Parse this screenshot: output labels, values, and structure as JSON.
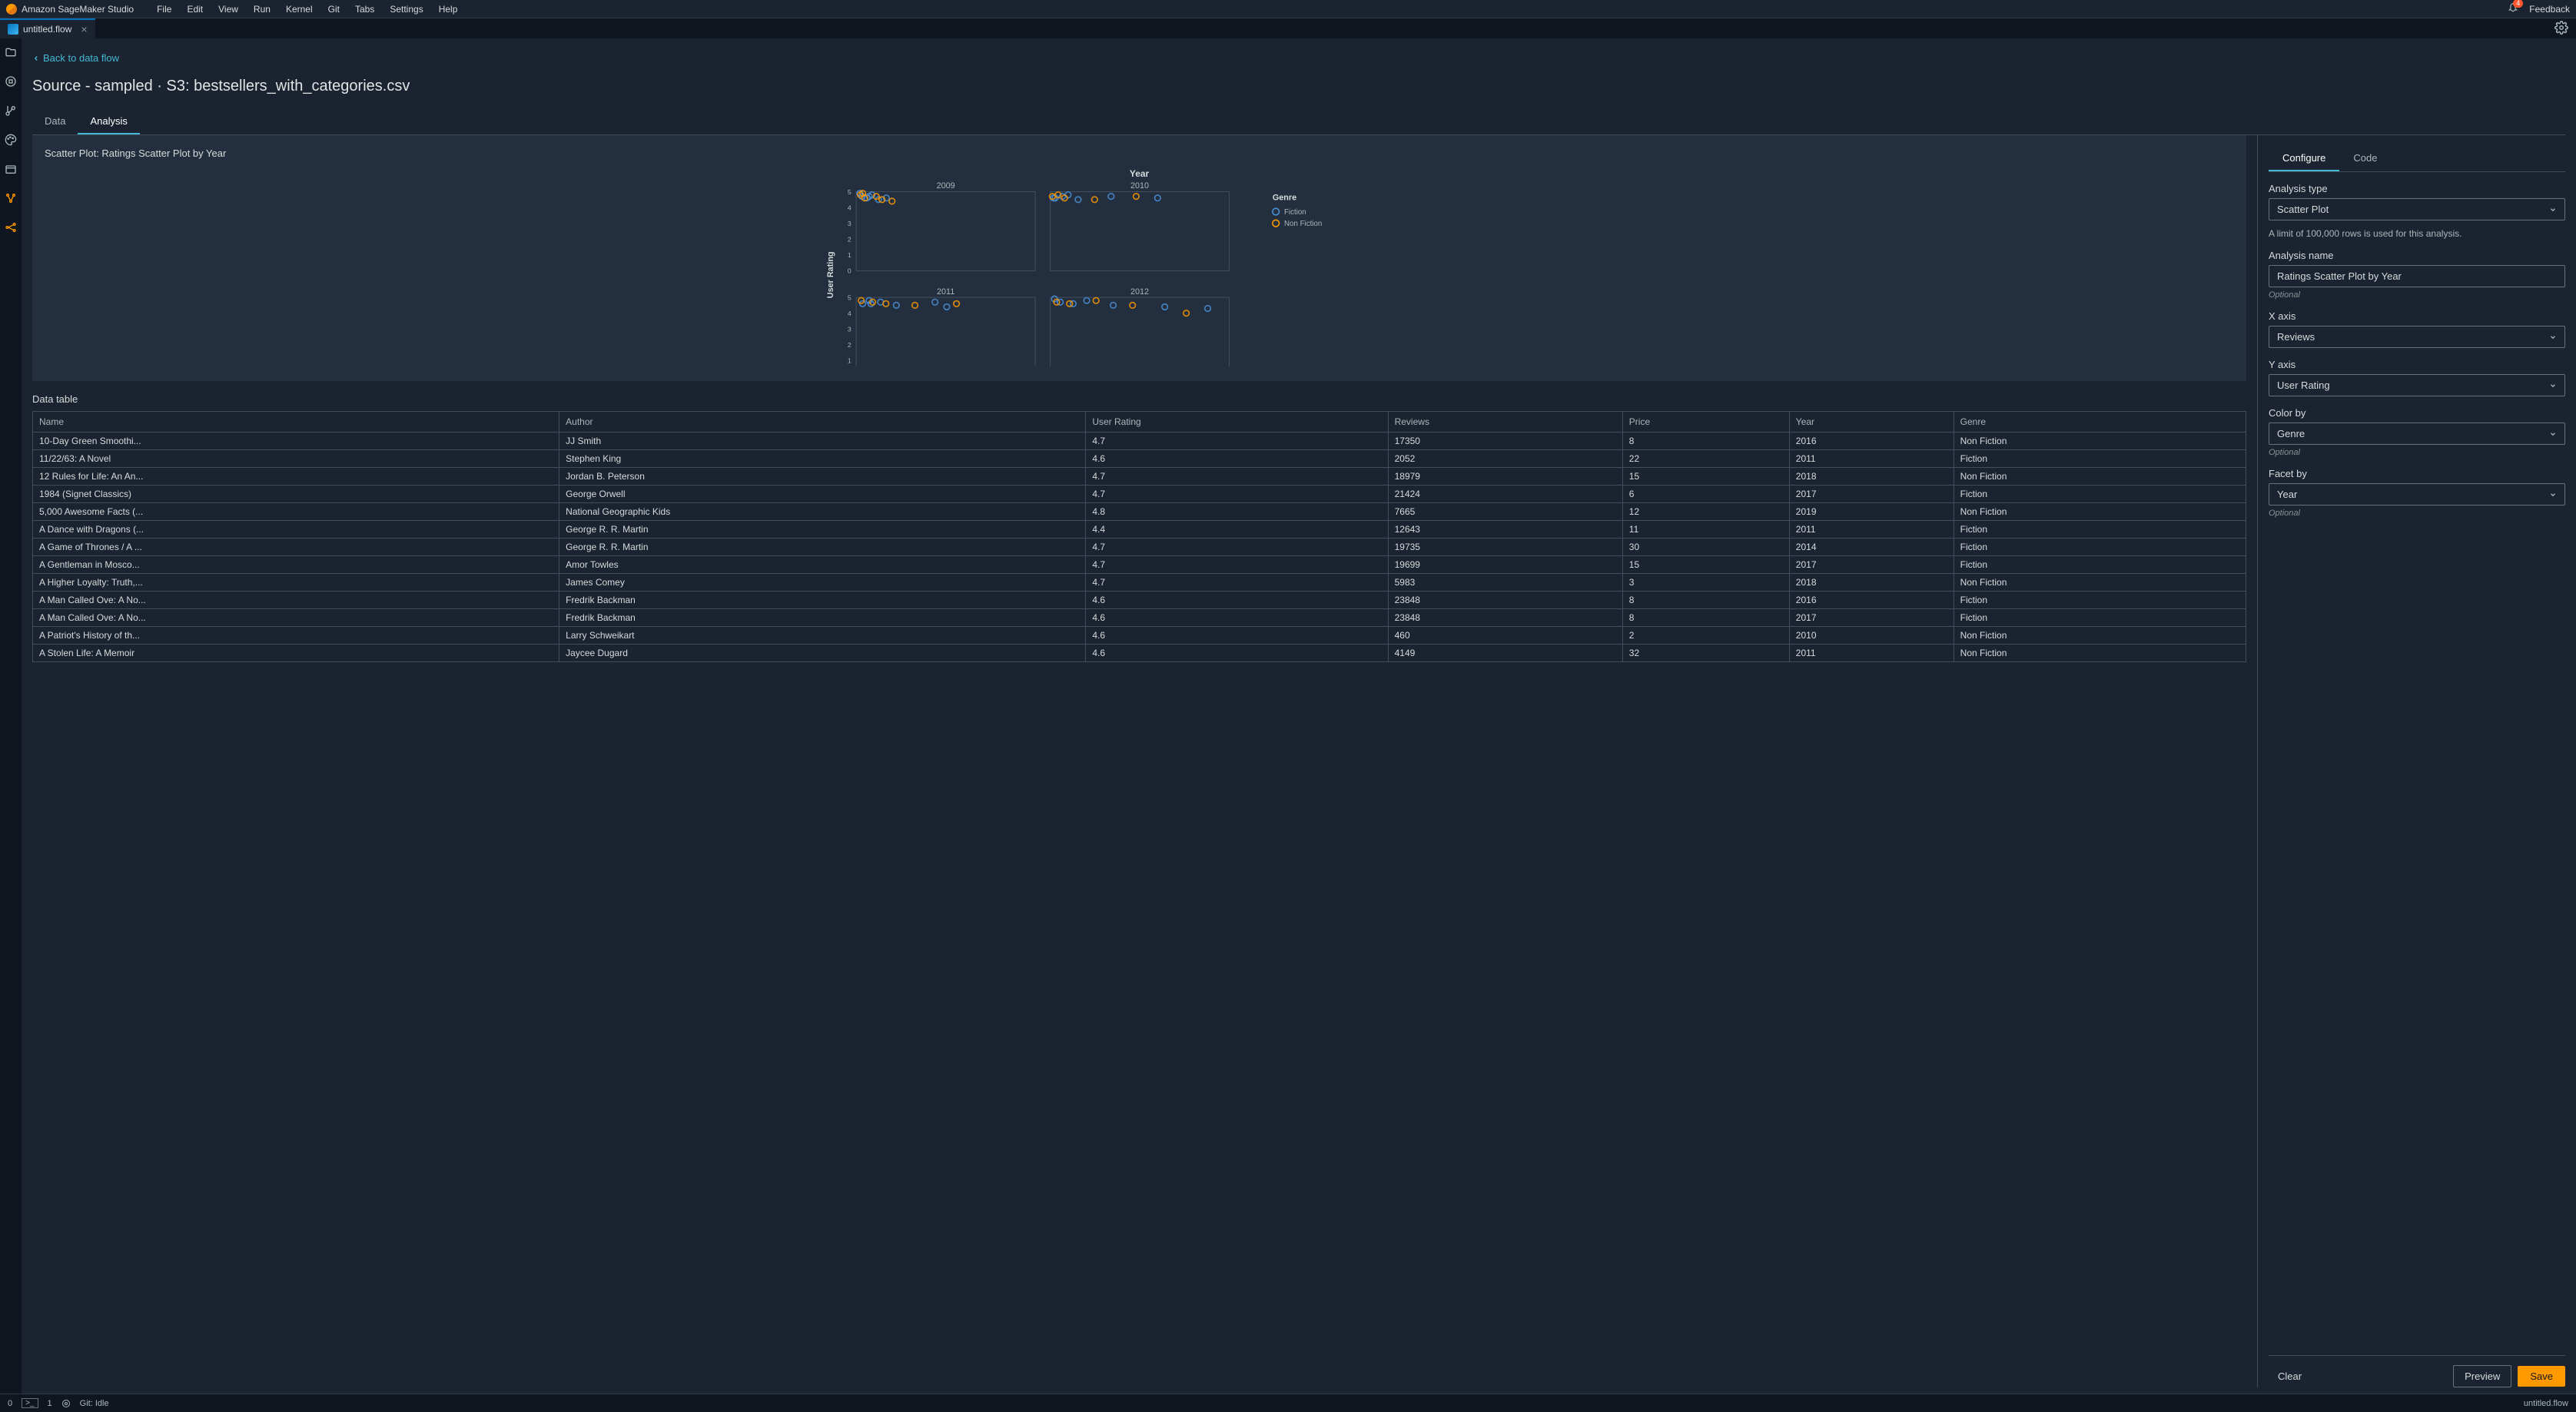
{
  "brand": "Amazon SageMaker Studio",
  "menu": [
    "File",
    "Edit",
    "View",
    "Run",
    "Kernel",
    "Git",
    "Tabs",
    "Settings",
    "Help"
  ],
  "notif_count": "4",
  "feedback": "Feedback",
  "tab_name": "untitled.flow",
  "back_link": "Back to data flow",
  "heading": "Source - sampled · S3: bestsellers_with_categories.csv",
  "subtabs": {
    "data": "Data",
    "analysis": "Analysis"
  },
  "chart": {
    "title": "Scatter Plot: Ratings Scatter Plot by Year",
    "facet_label": "Year",
    "y_axis": "User Rating",
    "facets": [
      "2009",
      "2010",
      "2011",
      "2012"
    ],
    "legend_title": "Genre",
    "legend": [
      "Fiction",
      "Non Fiction"
    ],
    "y_ticks": [
      "0",
      "1",
      "2",
      "3",
      "4",
      "5"
    ]
  },
  "data_table_label": "Data table",
  "columns": [
    "Name",
    "Author",
    "User Rating",
    "Reviews",
    "Price",
    "Year",
    "Genre"
  ],
  "rows": [
    [
      "10-Day Green Smoothi...",
      "JJ Smith",
      "4.7",
      "17350",
      "8",
      "2016",
      "Non Fiction"
    ],
    [
      "11/22/63: A Novel",
      "Stephen King",
      "4.6",
      "2052",
      "22",
      "2011",
      "Fiction"
    ],
    [
      "12 Rules for Life: An An...",
      "Jordan B. Peterson",
      "4.7",
      "18979",
      "15",
      "2018",
      "Non Fiction"
    ],
    [
      "1984 (Signet Classics)",
      "George Orwell",
      "4.7",
      "21424",
      "6",
      "2017",
      "Fiction"
    ],
    [
      "5,000 Awesome Facts (...",
      "National Geographic Kids",
      "4.8",
      "7665",
      "12",
      "2019",
      "Non Fiction"
    ],
    [
      "A Dance with Dragons (...",
      "George R. R. Martin",
      "4.4",
      "12643",
      "11",
      "2011",
      "Fiction"
    ],
    [
      "A Game of Thrones / A ...",
      "George R. R. Martin",
      "4.7",
      "19735",
      "30",
      "2014",
      "Fiction"
    ],
    [
      "A Gentleman in Mosco...",
      "Amor Towles",
      "4.7",
      "19699",
      "15",
      "2017",
      "Fiction"
    ],
    [
      "A Higher Loyalty: Truth,...",
      "James Comey",
      "4.7",
      "5983",
      "3",
      "2018",
      "Non Fiction"
    ],
    [
      "A Man Called Ove: A No...",
      "Fredrik Backman",
      "4.6",
      "23848",
      "8",
      "2016",
      "Fiction"
    ],
    [
      "A Man Called Ove: A No...",
      "Fredrik Backman",
      "4.6",
      "23848",
      "8",
      "2017",
      "Fiction"
    ],
    [
      "A Patriot's History of th...",
      "Larry Schweikart",
      "4.6",
      "460",
      "2",
      "2010",
      "Non Fiction"
    ],
    [
      "A Stolen Life: A Memoir",
      "Jaycee Dugard",
      "4.6",
      "4149",
      "32",
      "2011",
      "Non Fiction"
    ]
  ],
  "right": {
    "tabs": {
      "configure": "Configure",
      "code": "Code"
    },
    "analysis_type_label": "Analysis type",
    "analysis_type_value": "Scatter Plot",
    "info": "A limit of 100,000 rows is used for this analysis.",
    "analysis_name_label": "Analysis name",
    "analysis_name_value": "Ratings Scatter Plot by Year",
    "x_label": "X axis",
    "x_value": "Reviews",
    "y_label": "Y axis",
    "y_value": "User Rating",
    "color_label": "Color by",
    "color_value": "Genre",
    "facet_label": "Facet by",
    "facet_value": "Year",
    "optional": "Optional",
    "clear": "Clear",
    "preview": "Preview",
    "save": "Save"
  },
  "status": {
    "zero": "0",
    "one": "1",
    "git": "Git: Idle",
    "file": "untitled.flow"
  },
  "chart_data": {
    "type": "scatter",
    "facet_by": "Year",
    "color_by": "Genre",
    "x": "Reviews",
    "y": "User Rating",
    "ylim": [
      0,
      5
    ],
    "facets": {
      "2009": {
        "Fiction": [
          [
            800,
            4.7
          ],
          [
            1500,
            4.6
          ],
          [
            2200,
            4.8
          ],
          [
            3100,
            4.5
          ],
          [
            500,
            4.9
          ],
          [
            1800,
            4.7
          ],
          [
            4200,
            4.6
          ]
        ],
        "Non Fiction": [
          [
            600,
            4.8
          ],
          [
            1200,
            4.6
          ],
          [
            2800,
            4.7
          ],
          [
            3600,
            4.5
          ],
          [
            900,
            4.9
          ],
          [
            5000,
            4.4
          ]
        ]
      },
      "2010": {
        "Fiction": [
          [
            460,
            4.6
          ],
          [
            1700,
            4.7
          ],
          [
            2500,
            4.8
          ],
          [
            3900,
            4.5
          ],
          [
            700,
            4.6
          ],
          [
            8500,
            4.7
          ],
          [
            15000,
            4.6
          ]
        ],
        "Non Fiction": [
          [
            300,
            4.7
          ],
          [
            1100,
            4.8
          ],
          [
            2000,
            4.6
          ],
          [
            6200,
            4.5
          ],
          [
            12000,
            4.7
          ]
        ]
      },
      "2011": {
        "Fiction": [
          [
            2052,
            4.6
          ],
          [
            12643,
            4.4
          ],
          [
            1800,
            4.8
          ],
          [
            3400,
            4.7
          ],
          [
            900,
            4.6
          ],
          [
            5600,
            4.5
          ],
          [
            11000,
            4.7
          ]
        ],
        "Non Fiction": [
          [
            4149,
            4.6
          ],
          [
            700,
            4.8
          ],
          [
            2300,
            4.7
          ],
          [
            8200,
            4.5
          ],
          [
            14000,
            4.6
          ]
        ]
      },
      "2012": {
        "Fiction": [
          [
            1400,
            4.7
          ],
          [
            3200,
            4.6
          ],
          [
            5100,
            4.8
          ],
          [
            8800,
            4.5
          ],
          [
            600,
            4.9
          ],
          [
            16000,
            4.4
          ],
          [
            22000,
            4.3
          ]
        ],
        "Non Fiction": [
          [
            900,
            4.7
          ],
          [
            2700,
            4.6
          ],
          [
            6400,
            4.8
          ],
          [
            11500,
            4.5
          ],
          [
            19000,
            4.0
          ]
        ]
      }
    }
  }
}
